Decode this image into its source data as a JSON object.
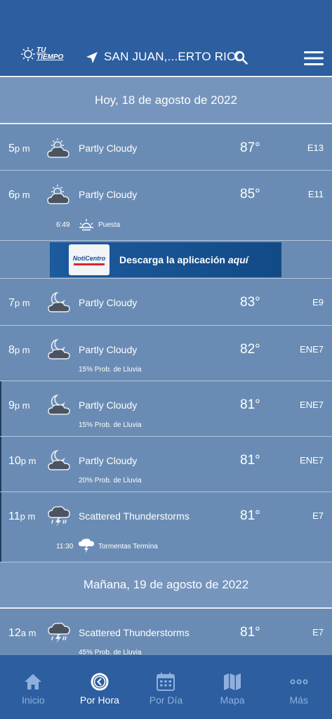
{
  "header": {
    "logo_line1": "TU",
    "logo_line2": "TIEMPO",
    "location": "SAN JUAN,...ERTO RICO"
  },
  "days": [
    {
      "label": "Hoy, 18 de agosto de 2022"
    },
    {
      "label": "Mañana, 19 de agosto de 2022"
    }
  ],
  "hours": [
    {
      "hour": "5",
      "ampm": "p m",
      "condition": "Partly Cloudy",
      "temp": "87°",
      "wind": "E13",
      "icon": "partly-cloudy-day-icon"
    },
    {
      "hour": "6",
      "ampm": "p m",
      "condition": "Partly Cloudy",
      "temp": "85°",
      "wind": "E11",
      "icon": "partly-cloudy-day-icon",
      "event_time": "6:49",
      "event_label": "Puesta",
      "event_icon": "sunset-icon"
    },
    {
      "hour": "7",
      "ampm": "p m",
      "condition": "Partly Cloudy",
      "temp": "83°",
      "wind": "E9",
      "icon": "partly-cloudy-night-icon"
    },
    {
      "hour": "8",
      "ampm": "p m",
      "condition": "Partly Cloudy",
      "temp": "82°",
      "wind": "ENE7",
      "icon": "partly-cloudy-night-icon",
      "prob": "15% Prob. de Lluvia"
    },
    {
      "hour": "9",
      "ampm": "p m",
      "condition": "Partly Cloudy",
      "temp": "81°",
      "wind": "ENE7",
      "icon": "partly-cloudy-night-icon",
      "prob": "15% Prob. de Lluvia"
    },
    {
      "hour": "10",
      "ampm": "p m",
      "condition": "Partly Cloudy",
      "temp": "81°",
      "wind": "ENE7",
      "icon": "partly-cloudy-night-icon",
      "prob": "20% Prob. de Lluvia"
    },
    {
      "hour": "11",
      "ampm": "p m",
      "condition": "Scattered Thunderstorms",
      "temp": "81°",
      "wind": "E7",
      "icon": "thunderstorm-icon",
      "event_time": "11:30",
      "event_label": "Tormentas Termina",
      "event_icon": "storm-end-icon"
    },
    {
      "hour": "12",
      "ampm": "a m",
      "condition": "Scattered Thunderstorms",
      "temp": "81°",
      "wind": "E7",
      "icon": "thunderstorm-icon",
      "prob": "45% Prob. de Lluvia"
    }
  ],
  "ad": {
    "logo_text": "NotiCentro",
    "text_main": "Descarga la aplicación",
    "text_emph": "aquí"
  },
  "tabs": [
    {
      "label": "Inicio",
      "icon": "home-icon"
    },
    {
      "label": "Por Hora",
      "icon": "clock-icon",
      "active": true
    },
    {
      "label": "Por Día",
      "icon": "calendar-icon"
    },
    {
      "label": "Mapa",
      "icon": "map-icon"
    },
    {
      "label": "Más",
      "icon": "more-icon"
    }
  ],
  "colors": {
    "header_bg": "#2c5ea0",
    "list_bg": "#6a8cb4",
    "day_header_bg": "#7695bd",
    "tab_inactive": "#8fb0dd"
  }
}
